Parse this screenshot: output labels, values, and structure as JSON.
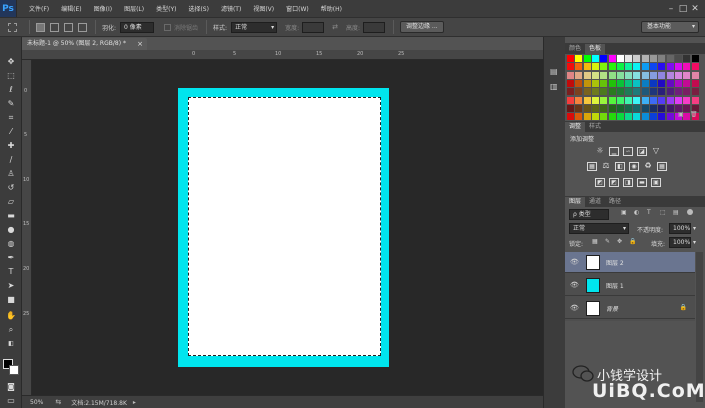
{
  "menubar": {
    "logo": "Ps",
    "items": [
      "文件(F)",
      "编辑(E)",
      "图像(I)",
      "图层(L)",
      "类型(Y)",
      "选择(S)",
      "滤镜(T)",
      "视图(V)",
      "窗口(W)",
      "帮助(H)"
    ],
    "window_buttons": [
      "–",
      "□",
      "✕"
    ]
  },
  "options": {
    "feather_label": "羽化:",
    "feather_value": "0 像素",
    "antialias_label": "消除锯齿",
    "style_label": "样式:",
    "style_value": "正常",
    "width_label": "宽度:",
    "height_label": "高度:",
    "refine_edge": "调整边缘 ...",
    "workspace": "基本功能"
  },
  "document": {
    "tab_title": "未标题-1 @ 50% (图层 2, RGB/8) *",
    "close": "×",
    "zoom": "50%",
    "doc_info": "文档:2.15M/718.8K",
    "ruler_h": [
      "0",
      "5",
      "10",
      "15",
      "20",
      "25"
    ],
    "ruler_v": [
      "0",
      "5",
      "10",
      "15",
      "20",
      "25"
    ],
    "cyan_color": "#00e5ee"
  },
  "color_panel": {
    "tabs": [
      "颜色",
      "色板"
    ]
  },
  "adjust_panel": {
    "tabs": [
      "调整",
      "样式"
    ],
    "title": "添加调整"
  },
  "layers_panel": {
    "tabs": [
      "图层",
      "通道",
      "路径"
    ],
    "kind": "ρ 类型",
    "blend": "正常",
    "opacity_label": "不透明度:",
    "opacity": "100%",
    "lock_label": "锁定:",
    "fill_label": "填充:",
    "fill": "100%",
    "layers": [
      {
        "name": "图层 2",
        "thumb": "#ffffff",
        "selected": true
      },
      {
        "name": "图层 1",
        "thumb": "#00e5ee",
        "selected": false
      },
      {
        "name": "背景",
        "thumb": "#ffffff",
        "selected": false,
        "locked": true
      }
    ]
  },
  "watermark": {
    "text": "小钱学设计",
    "site": "UiBQ.CoM"
  }
}
